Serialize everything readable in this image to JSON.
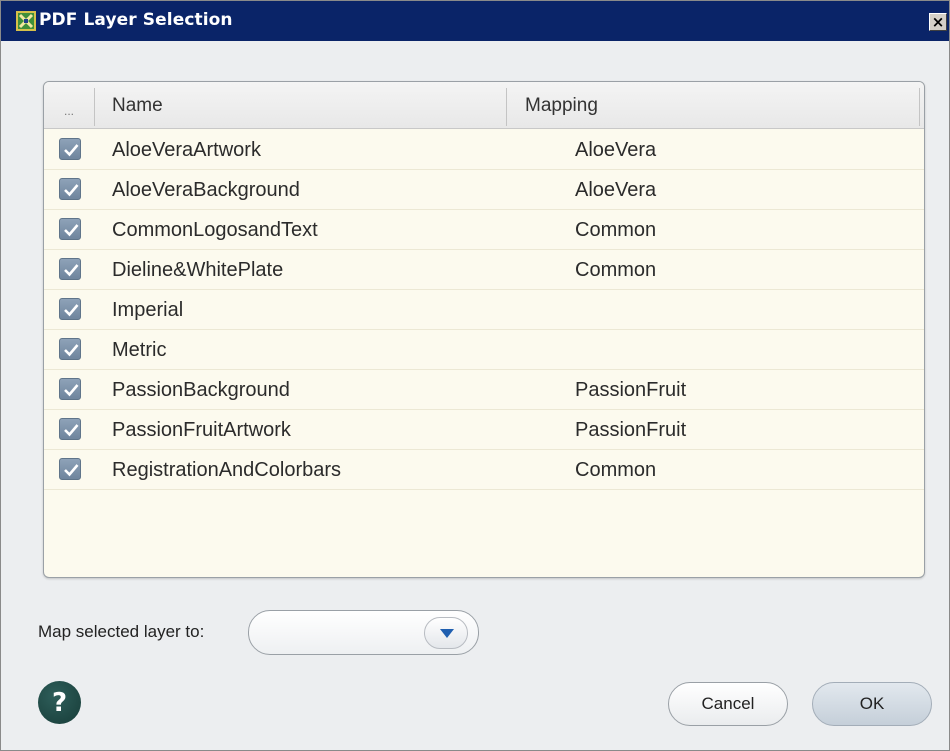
{
  "window": {
    "title": "PDF Layer Selection",
    "close_label": "×"
  },
  "table": {
    "columns": {
      "select_all": "...",
      "name": "Name",
      "mapping": "Mapping"
    },
    "rows": [
      {
        "checked": true,
        "name": "AloeVeraArtwork",
        "mapping": "AloeVera"
      },
      {
        "checked": true,
        "name": "AloeVeraBackground",
        "mapping": "AloeVera"
      },
      {
        "checked": true,
        "name": "CommonLogosandText",
        "mapping": "Common"
      },
      {
        "checked": true,
        "name": "Dieline&WhitePlate",
        "mapping": "Common"
      },
      {
        "checked": true,
        "name": "Imperial",
        "mapping": ""
      },
      {
        "checked": true,
        "name": "Metric",
        "mapping": ""
      },
      {
        "checked": true,
        "name": "PassionBackground",
        "mapping": "PassionFruit"
      },
      {
        "checked": true,
        "name": "PassionFruitArtwork",
        "mapping": "PassionFruit"
      },
      {
        "checked": true,
        "name": "RegistrationAndColorbars",
        "mapping": "Common"
      }
    ]
  },
  "mapping_control": {
    "label": "Map selected layer to:",
    "value": ""
  },
  "buttons": {
    "help": "?",
    "cancel": "Cancel",
    "ok": "OK"
  },
  "colors": {
    "titlebar": "#0a2468",
    "table_background": "#fcfaee",
    "checkbox": "#7a8fa6",
    "help_button": "#1f4743"
  },
  "icons": {
    "app": "pdf-layer-app-icon",
    "close": "close-icon",
    "checkbox": "check-icon",
    "dropdown": "chevron-down-icon",
    "help": "help-icon"
  }
}
